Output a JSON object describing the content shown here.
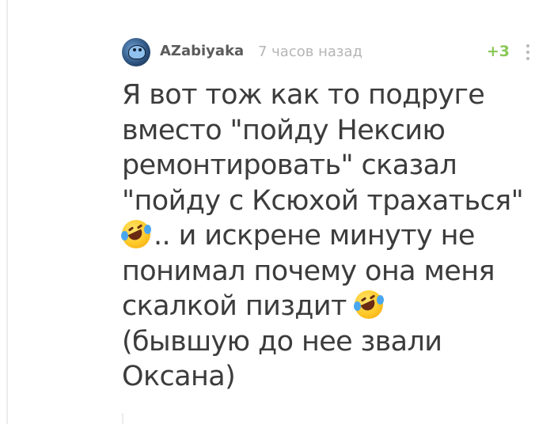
{
  "comment": {
    "author": "AZabiyaka",
    "time": "7 часов назад",
    "rating": "+3",
    "lines": [
      "Я вот тож как то подруге",
      "вместо \"пойду Нексию",
      "ремонтировать\" сказал",
      "\"пойду с Ксюхой трахаться\"",
      ".. и искрене минуту не",
      "понимал почему она меня",
      "скалкой пиздит",
      "(бывшую до нее звали",
      "Оксана)"
    ],
    "emoji_name": "rolling-on-floor-laughing-emoji",
    "more_icon": "vertical-ellipsis-icon",
    "colors": {
      "rating": "#8ac858",
      "text": "#3c3c3c",
      "time": "#b5b5b5"
    }
  }
}
